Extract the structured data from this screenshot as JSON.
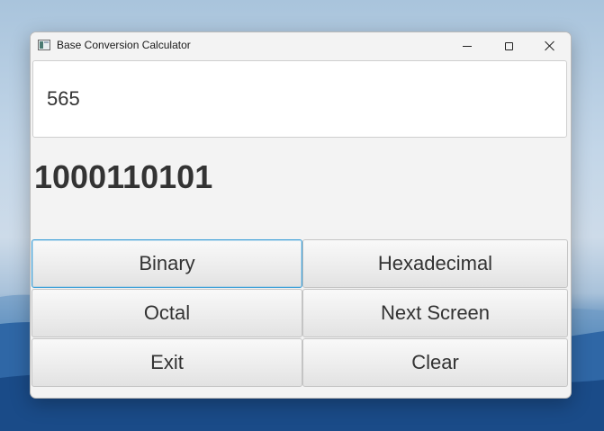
{
  "window": {
    "title": "Base Conversion Calculator"
  },
  "input": {
    "value": "565"
  },
  "result": {
    "text": "1000110101"
  },
  "buttons": {
    "binary": "Binary",
    "hexadecimal": "Hexadecimal",
    "octal": "Octal",
    "next_screen": "Next Screen",
    "exit": "Exit",
    "clear": "Clear"
  },
  "icons": {
    "app": "app-window-icon",
    "minimize": "minimize-icon",
    "maximize": "maximize-icon",
    "close": "close-icon"
  },
  "colors": {
    "focus_border": "#3ea0d8",
    "window_bg": "#f3f3f3",
    "result_text": "#333333"
  }
}
